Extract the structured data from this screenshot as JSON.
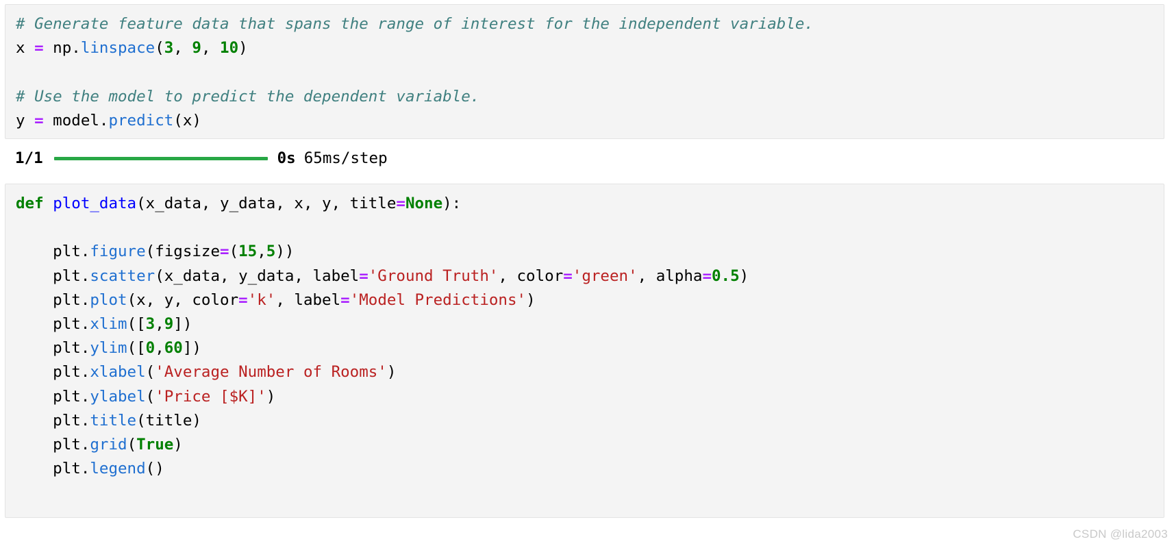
{
  "cells": [
    {
      "id": "cell-1",
      "lines": [
        [
          {
            "t": "# Generate feature data that spans the range of interest for the independent variable.",
            "c": "c"
          }
        ],
        [
          {
            "t": "x ",
            "c": "n"
          },
          {
            "t": "=",
            "c": "o"
          },
          {
            "t": " np",
            "c": "n"
          },
          {
            "t": ".",
            "c": "p"
          },
          {
            "t": "linspace",
            "c": "na"
          },
          {
            "t": "(",
            "c": "p"
          },
          {
            "t": "3",
            "c": "mi"
          },
          {
            "t": ", ",
            "c": "p"
          },
          {
            "t": "9",
            "c": "mi"
          },
          {
            "t": ", ",
            "c": "p"
          },
          {
            "t": "10",
            "c": "mi"
          },
          {
            "t": ")",
            "c": "p"
          }
        ],
        [],
        [
          {
            "t": "# Use the model to predict the dependent variable.",
            "c": "c"
          }
        ],
        [
          {
            "t": "y ",
            "c": "n"
          },
          {
            "t": "=",
            "c": "o"
          },
          {
            "t": " model",
            "c": "n"
          },
          {
            "t": ".",
            "c": "p"
          },
          {
            "t": "predict",
            "c": "na"
          },
          {
            "t": "(x)",
            "c": "p"
          }
        ]
      ]
    },
    {
      "id": "cell-2",
      "lines": [
        [
          {
            "t": "def",
            "c": "k"
          },
          {
            "t": " ",
            "c": "n"
          },
          {
            "t": "plot_data",
            "c": "nf"
          },
          {
            "t": "(x_data, y_data, x, y, title",
            "c": "p"
          },
          {
            "t": "=",
            "c": "o"
          },
          {
            "t": "None",
            "c": "k"
          },
          {
            "t": "):",
            "c": "p"
          }
        ],
        [],
        [
          {
            "t": "    plt",
            "c": "n"
          },
          {
            "t": ".",
            "c": "p"
          },
          {
            "t": "figure",
            "c": "na"
          },
          {
            "t": "(figsize",
            "c": "p"
          },
          {
            "t": "=",
            "c": "o"
          },
          {
            "t": "(",
            "c": "p"
          },
          {
            "t": "15",
            "c": "mi"
          },
          {
            "t": ",",
            "c": "p"
          },
          {
            "t": "5",
            "c": "mi"
          },
          {
            "t": "))",
            "c": "p"
          }
        ],
        [
          {
            "t": "    plt",
            "c": "n"
          },
          {
            "t": ".",
            "c": "p"
          },
          {
            "t": "scatter",
            "c": "na"
          },
          {
            "t": "(x_data, y_data, label",
            "c": "p"
          },
          {
            "t": "=",
            "c": "o"
          },
          {
            "t": "'Ground Truth'",
            "c": "s"
          },
          {
            "t": ", color",
            "c": "p"
          },
          {
            "t": "=",
            "c": "o"
          },
          {
            "t": "'green'",
            "c": "s"
          },
          {
            "t": ", alpha",
            "c": "p"
          },
          {
            "t": "=",
            "c": "o"
          },
          {
            "t": "0.5",
            "c": "mi"
          },
          {
            "t": ")",
            "c": "p"
          }
        ],
        [
          {
            "t": "    plt",
            "c": "n"
          },
          {
            "t": ".",
            "c": "p"
          },
          {
            "t": "plot",
            "c": "na"
          },
          {
            "t": "(x, y, color",
            "c": "p"
          },
          {
            "t": "=",
            "c": "o"
          },
          {
            "t": "'k'",
            "c": "s"
          },
          {
            "t": ", label",
            "c": "p"
          },
          {
            "t": "=",
            "c": "o"
          },
          {
            "t": "'Model Predictions'",
            "c": "s"
          },
          {
            "t": ")",
            "c": "p"
          }
        ],
        [
          {
            "t": "    plt",
            "c": "n"
          },
          {
            "t": ".",
            "c": "p"
          },
          {
            "t": "xlim",
            "c": "na"
          },
          {
            "t": "([",
            "c": "p"
          },
          {
            "t": "3",
            "c": "mi"
          },
          {
            "t": ",",
            "c": "p"
          },
          {
            "t": "9",
            "c": "mi"
          },
          {
            "t": "])",
            "c": "p"
          }
        ],
        [
          {
            "t": "    plt",
            "c": "n"
          },
          {
            "t": ".",
            "c": "p"
          },
          {
            "t": "ylim",
            "c": "na"
          },
          {
            "t": "([",
            "c": "p"
          },
          {
            "t": "0",
            "c": "mi"
          },
          {
            "t": ",",
            "c": "p"
          },
          {
            "t": "60",
            "c": "mi"
          },
          {
            "t": "])",
            "c": "p"
          }
        ],
        [
          {
            "t": "    plt",
            "c": "n"
          },
          {
            "t": ".",
            "c": "p"
          },
          {
            "t": "xlabel",
            "c": "na"
          },
          {
            "t": "(",
            "c": "p"
          },
          {
            "t": "'Average Number of Rooms'",
            "c": "s"
          },
          {
            "t": ")",
            "c": "p"
          }
        ],
        [
          {
            "t": "    plt",
            "c": "n"
          },
          {
            "t": ".",
            "c": "p"
          },
          {
            "t": "ylabel",
            "c": "na"
          },
          {
            "t": "(",
            "c": "p"
          },
          {
            "t": "'Price [$K]'",
            "c": "s"
          },
          {
            "t": ")",
            "c": "p"
          }
        ],
        [
          {
            "t": "    plt",
            "c": "n"
          },
          {
            "t": ".",
            "c": "p"
          },
          {
            "t": "title",
            "c": "na"
          },
          {
            "t": "(title)",
            "c": "p"
          }
        ],
        [
          {
            "t": "    plt",
            "c": "n"
          },
          {
            "t": ".",
            "c": "p"
          },
          {
            "t": "grid",
            "c": "na"
          },
          {
            "t": "(",
            "c": "p"
          },
          {
            "t": "True",
            "c": "k"
          },
          {
            "t": ")",
            "c": "p"
          }
        ],
        [
          {
            "t": "    plt",
            "c": "n"
          },
          {
            "t": ".",
            "c": "p"
          },
          {
            "t": "legend",
            "c": "na"
          },
          {
            "t": "()",
            "c": "p"
          }
        ]
      ]
    }
  ],
  "output": {
    "steps": "1/1",
    "time": "0s",
    "rate": "65ms/step",
    "progress_percent": 100,
    "progress_color": "#28a745"
  },
  "watermark": "CSDN @lida2003",
  "colors": {
    "cell_background": "#f4f4f4",
    "cell_border": "#e3e3e3",
    "page_background": "#ffffff",
    "comment": "#408080",
    "keyword": "#008000",
    "function": "#0000FF",
    "method": "#1f6fd0",
    "operator": "#AA22FF",
    "number": "#008000",
    "string": "#BA2121",
    "watermark": "#c9c9c9"
  }
}
